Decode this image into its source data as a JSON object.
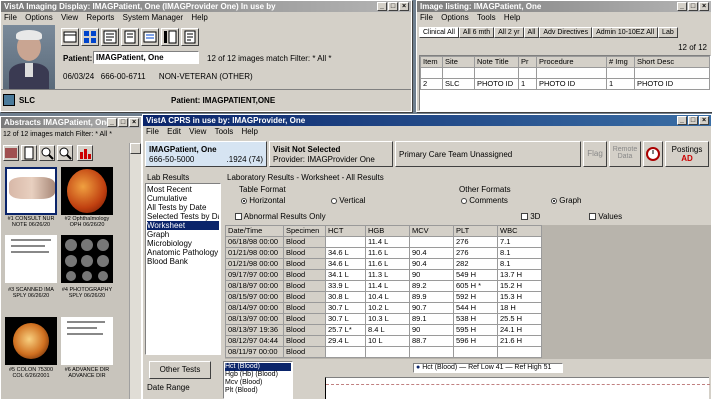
{
  "imaging": {
    "title": "VistA Imaging Display: IMAGPatient, One (IMAGProvider One) In use by",
    "menu": [
      "File",
      "Options",
      "View",
      "Reports",
      "System Manager",
      "Help"
    ],
    "patient_label": "Patient:",
    "patient_value": "IMAGPatient, One",
    "match_text": "12 of 12 images match Filter: * All *",
    "ssn_line": "06/03/24   666-00-6711      NON-VETERAN (OTHER)",
    "site": "SLC",
    "patient_line": "Patient: IMAGPATIENT,ONE"
  },
  "list_win": {
    "title": "Image listing: IMAGPatient, One",
    "menu": [
      "File",
      "Options",
      "Tools",
      "Help"
    ],
    "tabs": [
      "Clinical All",
      "All 6 mth",
      "All 2 yr",
      "All",
      "Adv Directives",
      "Admin 10-10EZ All",
      "Lab"
    ],
    "count": "12 of 12",
    "columns": [
      "Item",
      "Site",
      "Note Title",
      "Pr",
      "Procedure",
      "# Img",
      "Short Desc"
    ],
    "rows": [
      [
        "1",
        "SLC",
        "ADVANC...",
        "01",
        "ADVANCE DIREC...",
        "1",
        "ADVANCE DIR"
      ],
      [
        "2",
        "SLC",
        "PHOTO ID",
        "1",
        "PHOTO ID",
        "1",
        "PHOTO ID"
      ]
    ]
  },
  "abstracts": {
    "title": "Abstracts IMAGPatient, One",
    "match": "12 of 12 images match Filter: * All *",
    "captions": [
      "#1 CONSULT NUR\nNOTE 06/26/20",
      "#2 Ophthalmology\nOPH 06/26/20",
      "#3 SCANNED IMA\nSPLY 06/26/20",
      "#4 PHOTOGRAPHY\nSPLY 06/26/20",
      "#5 COLON 75300\nCOL 6/26/2001",
      "#6 ADVANCE DIR\nADVANCE DIR"
    ]
  },
  "cprs": {
    "title": "VistA CPRS in use by: IMAGProvider, One",
    "menu": [
      "File",
      "Edit",
      "View",
      "Tools",
      "Help"
    ],
    "patient_name": "IMAGPatient, One",
    "patient_ssn": "666-50-5000",
    "patient_dob": ".1924 (74)",
    "visit_title": "Visit Not Selected",
    "visit_provider": "Provider: IMAGProvider One",
    "team": "Primary Care Team Unassigned",
    "flag_label": "Flag",
    "remote_label": "Remote Data",
    "postings_label": "Postings",
    "postings_value": "AD",
    "lab_results_label": "Lab Results",
    "lab_items": [
      "Most Recent",
      "Cumulative",
      "All Tests by Date",
      "Selected Tests by Da",
      "Worksheet",
      "Graph",
      "Microbiology",
      "Anatomic Pathology",
      "Blood Bank"
    ],
    "lab_selected_index": 4,
    "worksheet_header": "Laboratory Results - Worksheet - All Results",
    "table_format_label": "Table Format",
    "horizontal_label": "Horizontal",
    "vertical_label": "Vertical",
    "other_formats_label": "Other Formats",
    "comments_label": "Comments",
    "graph_label": "Graph",
    "abnormal_label": "Abnormal Results Only",
    "threed_label": "3D",
    "values_label": "Values",
    "other_tests_label": "Other Tests",
    "date_range_label": "Date Range",
    "tests_list": [
      "Hct (Blood)",
      "Hgb (Hb) (Blood)",
      "Mcv (Blood)",
      "Plt (Blood)"
    ],
    "legend_text": "Hct (Blood)  — Ref Low 41  — Ref High 51",
    "columns": [
      "Date/Time",
      "Specimen",
      "HCT",
      "HGB",
      "MCV",
      "PLT",
      "WBC"
    ],
    "rows": [
      [
        "06/18/98 00:00",
        "Blood",
        "35.3 L",
        "11.4 L",
        "",
        "276",
        "7.1"
      ],
      [
        "01/21/98 00:00",
        "Blood",
        "34.6 L",
        "11.6 L",
        "90.4",
        "276",
        "8.1"
      ],
      [
        "01/21/98 00:00",
        "Blood",
        "34.6 L",
        "11.6 L",
        "90.4",
        "282",
        "8.1"
      ],
      [
        "09/17/97 00:00",
        "Blood",
        "34.1 L",
        "11.3 L",
        "90",
        "549 H",
        "13.7 H"
      ],
      [
        "08/18/97 00:00",
        "Blood",
        "33.9 L",
        "11.4 L",
        "89.2",
        "605 H *",
        "15.2 H"
      ],
      [
        "08/15/97 00:00",
        "Blood",
        "30.8 L",
        "10.4 L",
        "89.9",
        "592 H",
        "15.3 H"
      ],
      [
        "08/14/97 00:00",
        "Blood",
        "30.7 L",
        "10.2 L",
        "90.7",
        "544 H",
        "18 H"
      ],
      [
        "08/13/97 00:00",
        "Blood",
        "30.7 L",
        "10.3 L",
        "89.1",
        "538 H",
        "25.5 H"
      ],
      [
        "08/13/97 19:36",
        "Blood",
        "25.7 L*",
        "8.4 L",
        "90",
        "595 H",
        "24.1 H"
      ],
      [
        "08/12/97 04:44",
        "Blood",
        "29.4 L",
        "10 L",
        "88.7",
        "596 H",
        "21.6 H"
      ],
      [
        "08/11/97 00:00",
        "Blood",
        "",
        "",
        "",
        "",
        ""
      ]
    ]
  },
  "colors": {
    "title_active": "#0a246a",
    "selection": "#0a246a",
    "desktop": "#6f7f8f",
    "cprs_patient_bg": "#d6e4f2"
  }
}
